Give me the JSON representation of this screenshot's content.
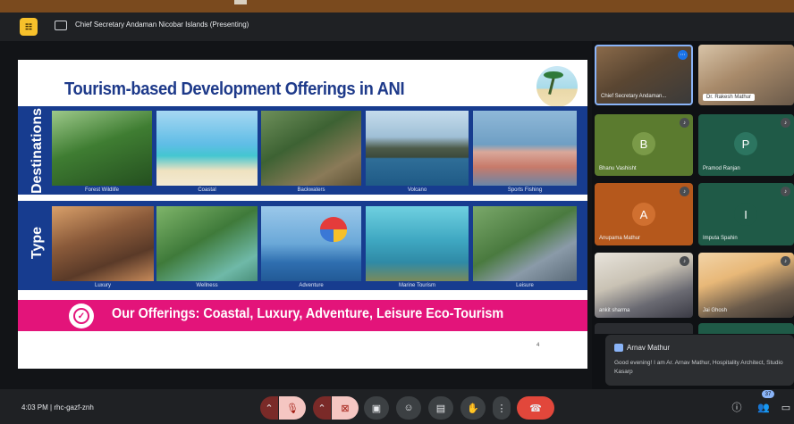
{
  "meeting": {
    "presenting_label": "Chief Secretary Andaman Nicobar Islands (Presenting)",
    "time": "4:03 PM",
    "meeting_code": "rhc-gazf-znh",
    "participants_count": "37"
  },
  "slide": {
    "title": "Tourism-based Development Offerings in ANI",
    "row1_label": "Destinations",
    "row2_label": "Type",
    "destinations": [
      "Forest Wildlife",
      "Coastal",
      "Backwaters",
      "Volcano",
      "Sports Fishing"
    ],
    "types": [
      "Luxury",
      "Wellness",
      "Adventure",
      "Marine Tourism",
      "Leisure"
    ],
    "offerings": "Our Offerings: Coastal, Luxury, Adventure, Leisure Eco-Tourism",
    "page_number": "4",
    "colors": {
      "banner_blue": "#173c8f",
      "title_blue": "#1e3a8a",
      "accent_pink": "#e3147a"
    }
  },
  "participants": [
    {
      "name": "Chief Secretary Andaman...",
      "type": "video"
    },
    {
      "name": "Dr. Rakesh Mathur",
      "type": "video"
    },
    {
      "name": "Bhanu Vashisht",
      "initial": "B",
      "color": "#5b7b2f"
    },
    {
      "name": "Pramod Ranjan",
      "initial": "P",
      "color": "#1f5a47"
    },
    {
      "name": "Anupama Mathur",
      "initial": "A",
      "color": "#b5581c"
    },
    {
      "name": "Imputa Spahin",
      "initial": "I",
      "color": "#1f5a47"
    },
    {
      "name": "ankit sharma",
      "type": "video"
    },
    {
      "name": "Jai Ghosh",
      "type": "video"
    }
  ],
  "chat": {
    "sender": "Arnav Mathur",
    "message": "Good evening! I am Ar. Arnav Mathur, Hospitality Architect, Studio Kasarp"
  },
  "controls": {
    "icons": [
      "chevron-up-icon",
      "mic-off-icon",
      "chevron-up-icon",
      "camera-off-icon",
      "present-icon",
      "emoji-icon",
      "captions-icon",
      "raise-hand-icon",
      "more-icon",
      "end-call-icon"
    ],
    "right_icons": [
      "info-icon",
      "people-icon",
      "chat-icon"
    ]
  }
}
